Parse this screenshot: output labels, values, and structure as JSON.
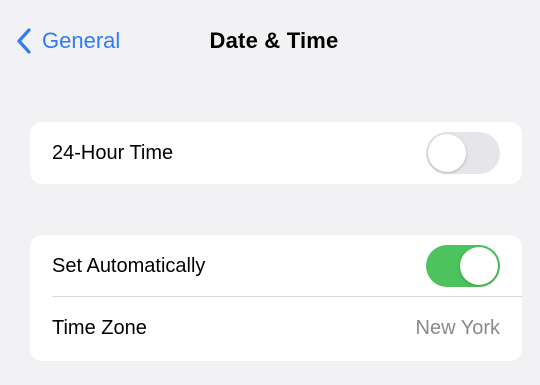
{
  "nav": {
    "back_label": "General",
    "title": "Date & Time",
    "back_icon": "chevron-left-icon"
  },
  "settings": {
    "hour24": {
      "label": "24-Hour Time",
      "enabled": false
    },
    "set_automatically": {
      "label": "Set Automatically",
      "enabled": true
    },
    "time_zone": {
      "label": "Time Zone",
      "value": "New York"
    }
  },
  "colors": {
    "accent": "#2f7cf6",
    "toggle_on": "#4cc35c",
    "toggle_off": "#e5e5ea",
    "background": "#f2f2f4",
    "secondary_text": "#8a8a8e"
  }
}
